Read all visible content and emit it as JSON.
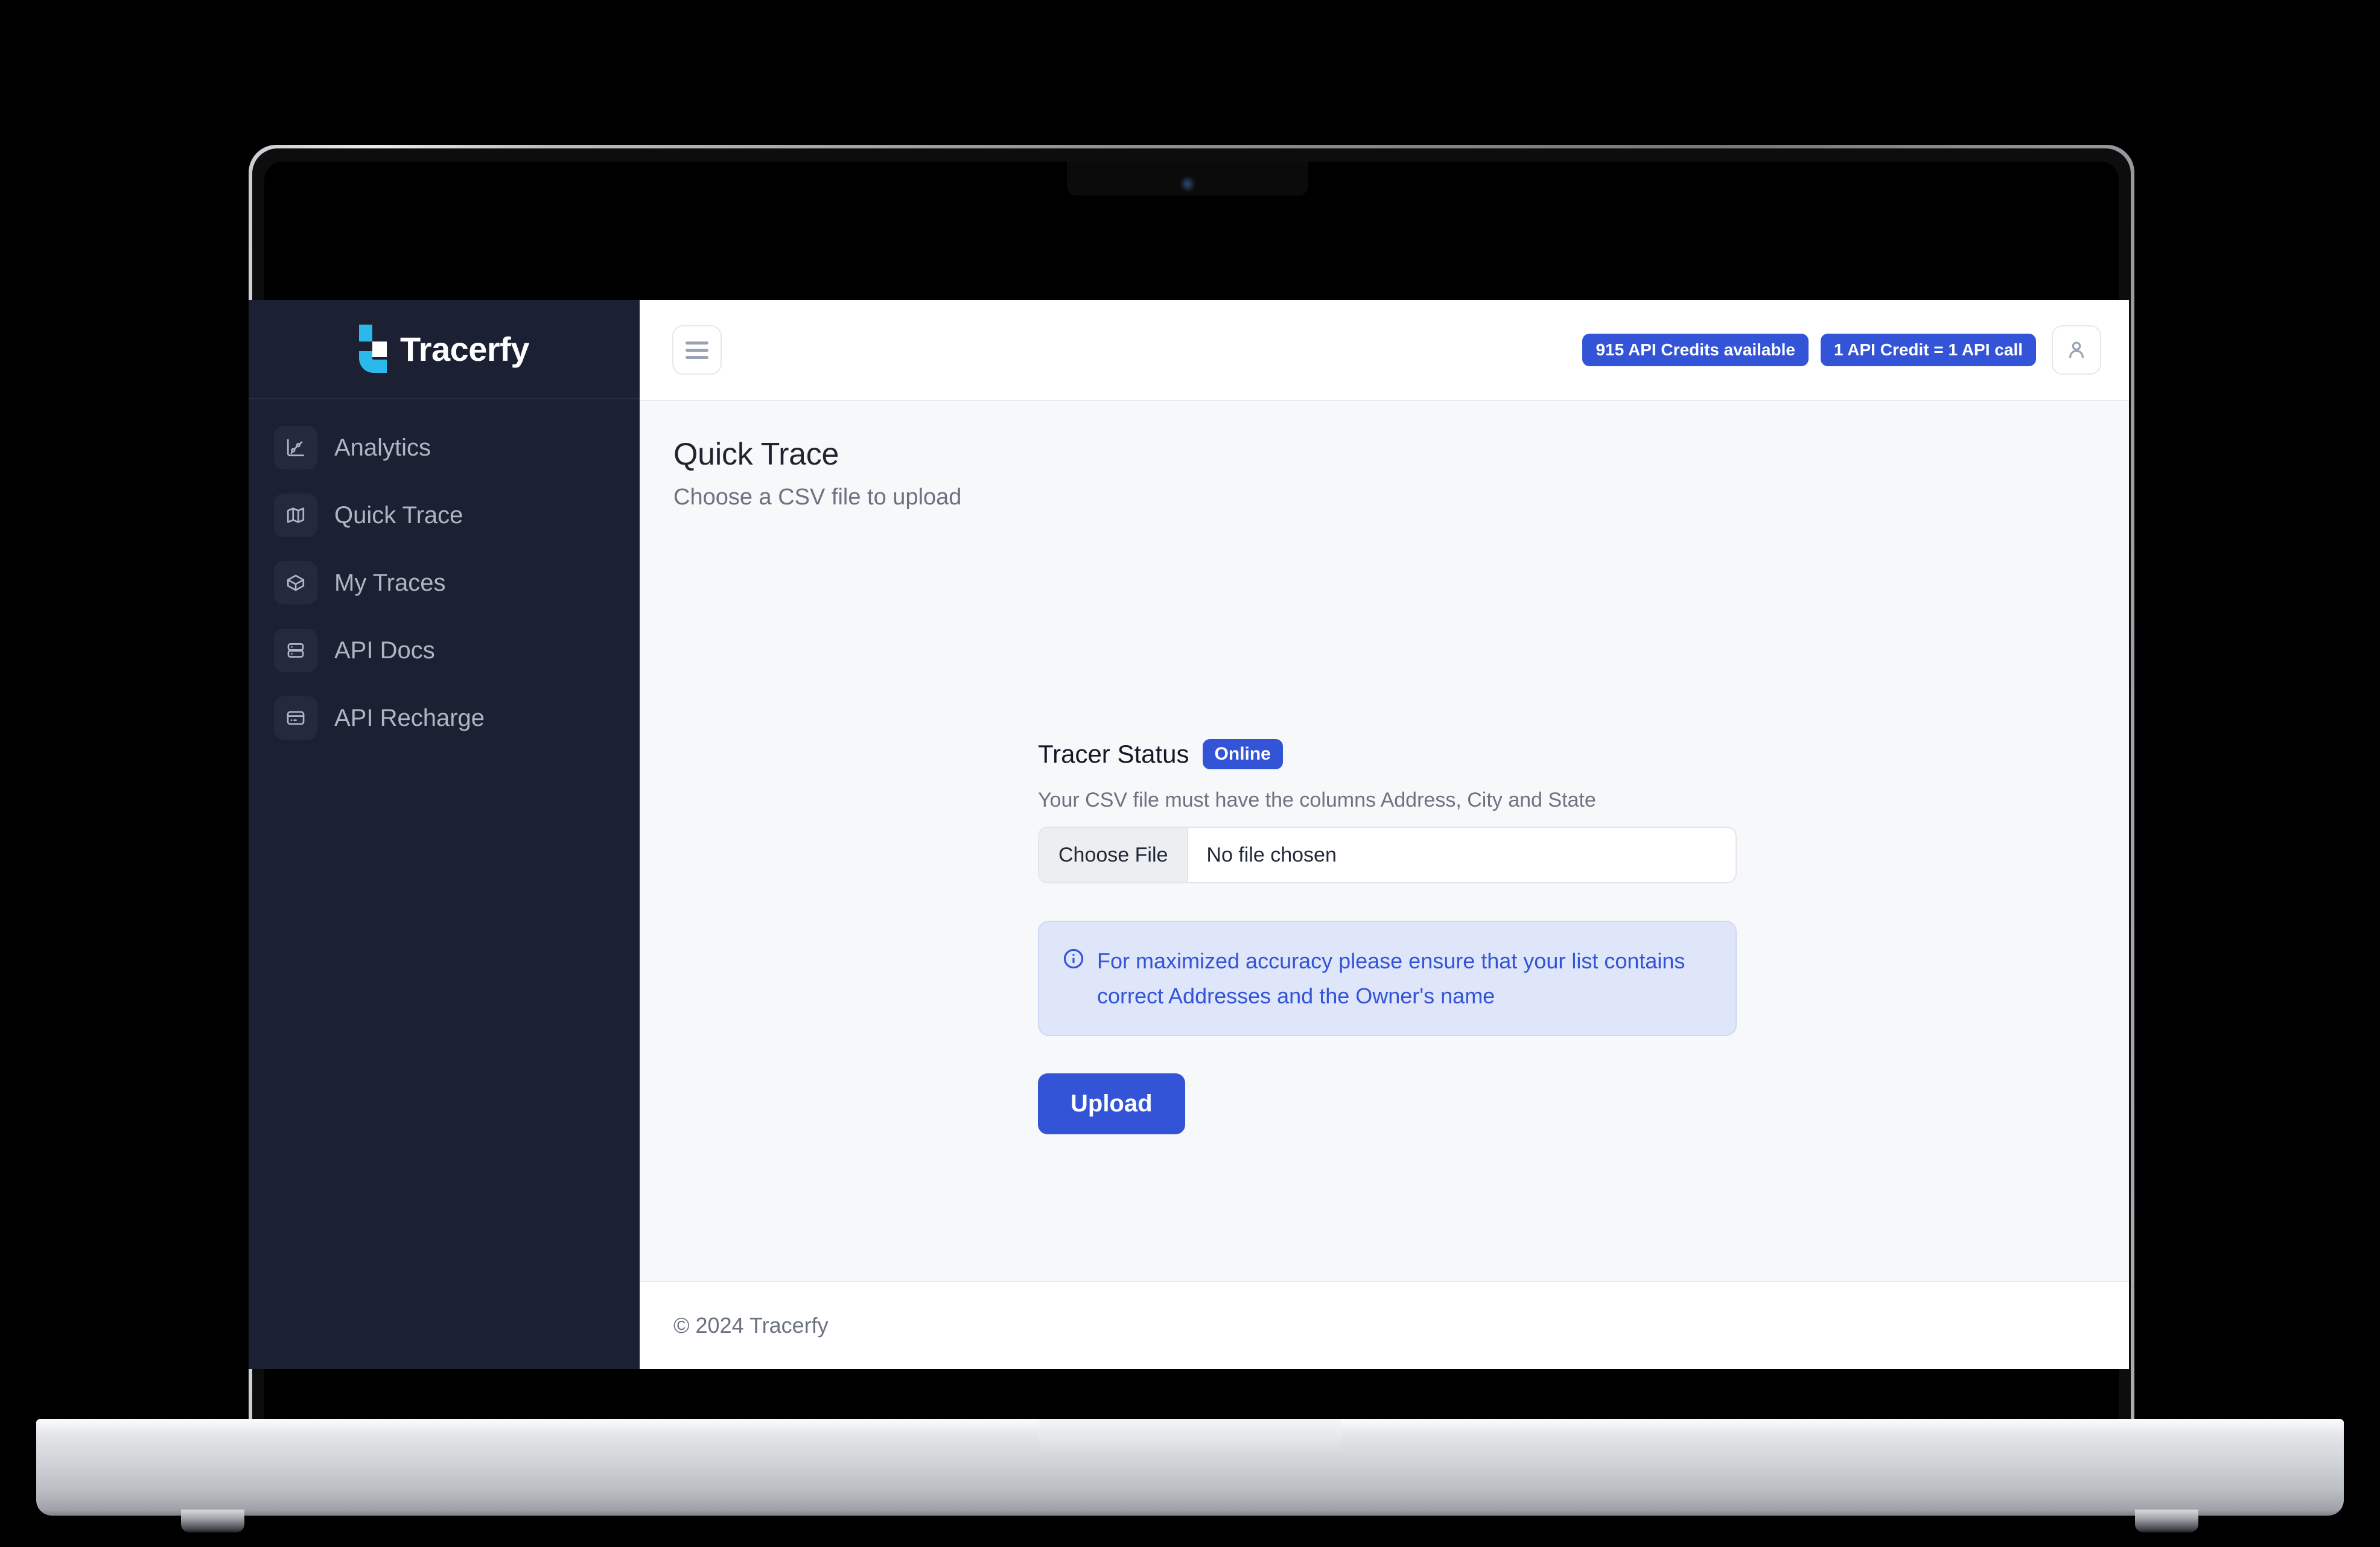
{
  "brand": {
    "name": "Tracerfy",
    "logo_icon": "tracerfy-logo-icon",
    "accent_color": "#2bb8ea",
    "primary_color": "#3354d6",
    "sidebar_color": "#1b2133"
  },
  "sidebar": {
    "items": [
      {
        "label": "Analytics",
        "icon": "analytics-chart-icon"
      },
      {
        "label": "Quick Trace",
        "icon": "map-icon"
      },
      {
        "label": "My Traces",
        "icon": "package-box-icon"
      },
      {
        "label": "API Docs",
        "icon": "server-database-icon"
      },
      {
        "label": "API Recharge",
        "icon": "credit-card-icon"
      }
    ]
  },
  "topbar": {
    "menu_toggle_icon": "hamburger-menu-icon",
    "credits_badge": "915 API Credits available",
    "conversion_badge": "1 API Credit = 1 API call",
    "profile_icon": "user-person-icon"
  },
  "page": {
    "title": "Quick Trace",
    "subtitle": "Choose a CSV file to upload"
  },
  "form": {
    "tracer_status_label": "Tracer Status",
    "tracer_status_value": "Online",
    "csv_hint": "Your CSV file must have the columns Address, City and State",
    "choose_file_label": "Choose File",
    "file_name": "No file chosen",
    "info_icon": "info-circle-icon",
    "info_text": "For maximized accuracy please ensure that your list contains correct Addresses and the Owner's name",
    "upload_label": "Upload"
  },
  "footer": {
    "copyright": "© 2024 Tracerfy"
  }
}
